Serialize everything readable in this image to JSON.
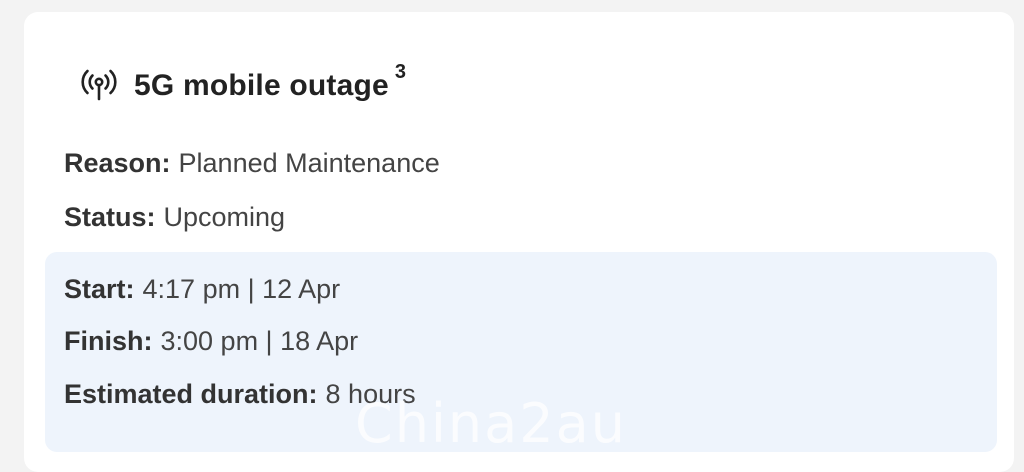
{
  "outage": {
    "title": "5G mobile outage",
    "footnote": "3",
    "icon": "broadcast-tower-icon"
  },
  "details": {
    "reason_label": "Reason:",
    "reason_value": "Planned Maintenance",
    "status_label": "Status:",
    "status_value": "Upcoming"
  },
  "schedule": {
    "start_label": "Start:",
    "start_value": "4:17 pm | 12 Apr",
    "finish_label": "Finish:",
    "finish_value": "3:00 pm | 18 Apr",
    "duration_label": "Estimated duration:",
    "duration_value": "8 hours"
  },
  "watermark": "China2au"
}
